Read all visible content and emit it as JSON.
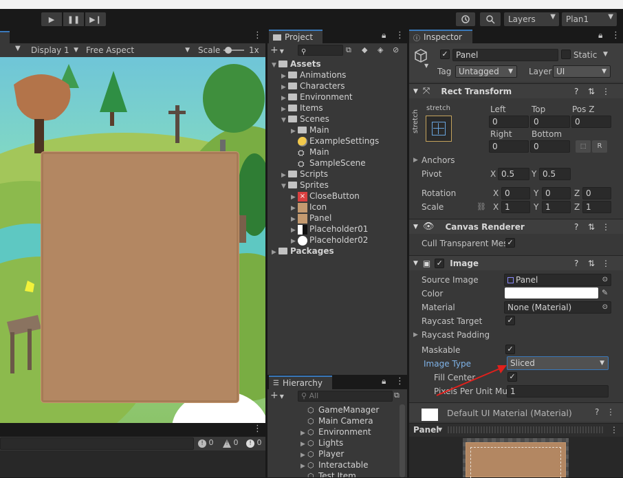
{
  "toolbar": {
    "play_label": "▶",
    "pause_label": "❚❚",
    "step_label": "▶❙",
    "history_icon": "history-icon",
    "search_icon": "search-icon",
    "layers_label": "Layers",
    "layout_label": "Plan1"
  },
  "game_view": {
    "display_label": "Display 1",
    "aspect_label": "Free Aspect",
    "scale_label": "Scale",
    "scale_value": "1x",
    "console_counts": [
      "0",
      "0",
      "0"
    ]
  },
  "project": {
    "tab_label": "Project",
    "tree": [
      {
        "label": "Assets",
        "indent": 0,
        "arrow": "▼",
        "icon": "folder",
        "bold": true
      },
      {
        "label": "Animations",
        "indent": 1,
        "arrow": "▶",
        "icon": "folder"
      },
      {
        "label": "Characters",
        "indent": 1,
        "arrow": "▶",
        "icon": "folder"
      },
      {
        "label": "Environment",
        "indent": 1,
        "arrow": "▶",
        "icon": "folder"
      },
      {
        "label": "Items",
        "indent": 1,
        "arrow": "▶",
        "icon": "folder"
      },
      {
        "label": "Scenes",
        "indent": 1,
        "arrow": "▼",
        "icon": "folder"
      },
      {
        "label": "Main",
        "indent": 2,
        "arrow": "▶",
        "icon": "folder"
      },
      {
        "label": "ExampleSettings",
        "indent": 2,
        "arrow": "",
        "icon": "settings"
      },
      {
        "label": "Main",
        "indent": 2,
        "arrow": "",
        "icon": "unity"
      },
      {
        "label": "SampleScene",
        "indent": 2,
        "arrow": "",
        "icon": "unity"
      },
      {
        "label": "Scripts",
        "indent": 1,
        "arrow": "▶",
        "icon": "folder"
      },
      {
        "label": "Sprites",
        "indent": 1,
        "arrow": "▼",
        "icon": "folder"
      },
      {
        "label": "CloseButton",
        "indent": 2,
        "arrow": "▶",
        "icon": "close"
      },
      {
        "label": "Icon",
        "indent": 2,
        "arrow": "▶",
        "icon": "tan"
      },
      {
        "label": "Panel",
        "indent": 2,
        "arrow": "▶",
        "icon": "tan"
      },
      {
        "label": "Placeholder01",
        "indent": 2,
        "arrow": "▶",
        "icon": "half"
      },
      {
        "label": "Placeholder02",
        "indent": 2,
        "arrow": "▶",
        "icon": "circle"
      },
      {
        "label": "Packages",
        "indent": 0,
        "arrow": "▶",
        "icon": "folder",
        "bold": true
      }
    ]
  },
  "hierarchy": {
    "tab_label": "Hierarchy",
    "search_placeholder": "All",
    "items": [
      {
        "label": "GameManager",
        "arrow": ""
      },
      {
        "label": "Main Camera",
        "arrow": ""
      },
      {
        "label": "Environment",
        "arrow": "▶"
      },
      {
        "label": "Lights",
        "arrow": "▶"
      },
      {
        "label": "Player",
        "arrow": "▶"
      },
      {
        "label": "Interactable",
        "arrow": "▶"
      },
      {
        "label": "Test Item",
        "arrow": ""
      }
    ]
  },
  "inspector": {
    "tab_label": "Inspector",
    "object_name": "Panel",
    "static_label": "Static",
    "tag_label": "Tag",
    "tag_value": "Untagged",
    "layer_label": "Layer",
    "layer_value": "UI",
    "rect_transform": {
      "title": "Rect Transform",
      "stretch_label": "stretch",
      "left_label": "Left",
      "left_value": "0",
      "top_label": "Top",
      "top_value": "0",
      "posz_label": "Pos Z",
      "posz_value": "0",
      "right_label": "Right",
      "right_value": "0",
      "bottom_label": "Bottom",
      "bottom_value": "0",
      "r_button": "R",
      "anchors_label": "Anchors",
      "pivot_label": "Pivot",
      "pivot_x": "0.5",
      "pivot_y": "0.5",
      "rotation_label": "Rotation",
      "rot_x": "0",
      "rot_y": "0",
      "rot_z": "0",
      "scale_label": "Scale",
      "scale_x": "1",
      "scale_y": "1",
      "scale_z": "1",
      "x": "X",
      "y": "Y",
      "z": "Z"
    },
    "canvas_renderer": {
      "title": "Canvas Renderer",
      "cull_label": "Cull Transparent Mes"
    },
    "image": {
      "title": "Image",
      "source_label": "Source Image",
      "source_value": "Panel",
      "color_label": "Color",
      "color_value": "#ffffff",
      "material_label": "Material",
      "material_value": "None (Material)",
      "raycast_label": "Raycast Target",
      "raycast_padding_label": "Raycast Padding",
      "maskable_label": "Maskable",
      "image_type_label": "Image Type",
      "image_type_value": "Sliced",
      "fill_center_label": "Fill Center",
      "ppu_label": "Pixels Per Unit Mul",
      "ppu_value": "1"
    },
    "material_footer": "Default UI Material (Material)",
    "preview_label": "Panel"
  },
  "colors": {
    "accent_blue": "#3a79bb",
    "panel_tan": "#b38762",
    "annotation_red": "#e0201c"
  }
}
